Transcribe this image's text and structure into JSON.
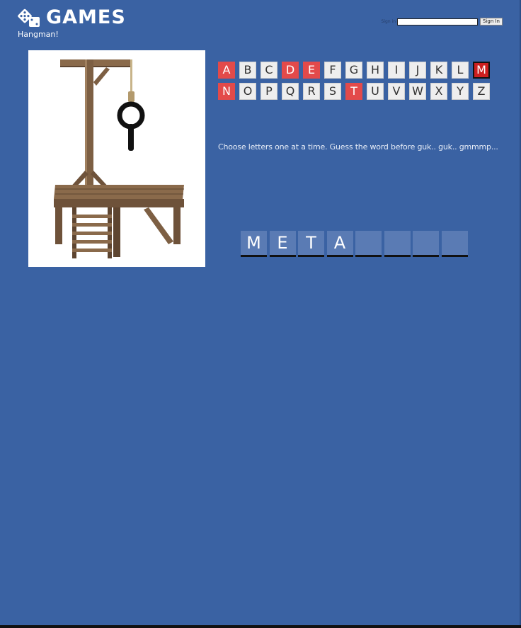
{
  "header": {
    "logo_text": "GAMES",
    "subtitle": "Hangman!",
    "icon": "dice-icon"
  },
  "signin": {
    "label": "Sign in",
    "input_value": "",
    "button_label": "Sign In"
  },
  "gallows": {
    "icon": "gallows-image"
  },
  "letters": {
    "row1": [
      {
        "letter": "A",
        "state": "used"
      },
      {
        "letter": "B",
        "state": "available"
      },
      {
        "letter": "C",
        "state": "available"
      },
      {
        "letter": "D",
        "state": "used"
      },
      {
        "letter": "E",
        "state": "used"
      },
      {
        "letter": "F",
        "state": "available"
      },
      {
        "letter": "G",
        "state": "available"
      },
      {
        "letter": "H",
        "state": "available"
      },
      {
        "letter": "I",
        "state": "available"
      },
      {
        "letter": "J",
        "state": "available"
      },
      {
        "letter": "K",
        "state": "available"
      },
      {
        "letter": "L",
        "state": "available"
      },
      {
        "letter": "M",
        "state": "last"
      }
    ],
    "row2": [
      {
        "letter": "N",
        "state": "used"
      },
      {
        "letter": "O",
        "state": "available"
      },
      {
        "letter": "P",
        "state": "available"
      },
      {
        "letter": "Q",
        "state": "available"
      },
      {
        "letter": "R",
        "state": "available"
      },
      {
        "letter": "S",
        "state": "available"
      },
      {
        "letter": "T",
        "state": "used"
      },
      {
        "letter": "U",
        "state": "available"
      },
      {
        "letter": "V",
        "state": "available"
      },
      {
        "letter": "W",
        "state": "available"
      },
      {
        "letter": "X",
        "state": "available"
      },
      {
        "letter": "Y",
        "state": "available"
      },
      {
        "letter": "Z",
        "state": "available"
      }
    ]
  },
  "instructions": "Choose letters one at a time. Guess the word before guk.. guk.. gmmmp...",
  "word": {
    "slots": [
      "M",
      "E",
      "T",
      "A",
      "",
      "",
      "",
      ""
    ]
  },
  "colors": {
    "background": "#3a62a3",
    "used_letter": "#e34a4a",
    "last_letter": "#cc1f1f"
  }
}
